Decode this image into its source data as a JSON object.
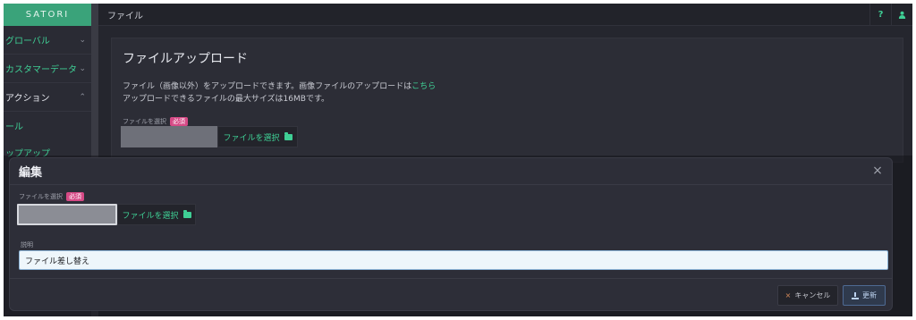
{
  "sidebar": {
    "brand": "SATORI",
    "items": [
      {
        "label": "グローバル",
        "chevron": "⌄"
      },
      {
        "label": "カスタマーデータ",
        "chevron": "⌄"
      },
      {
        "label": "アクション",
        "chevron": "⌃"
      }
    ],
    "subitems": [
      "ール",
      "ップアップ"
    ]
  },
  "topbar": {
    "title": "ファイル",
    "help": "?",
    "user_icon": "user-icon"
  },
  "card": {
    "heading": "ファイルアップロード",
    "desc_line1": "ファイル（画像以外）をアップロードできます。画像ファイルのアップロードは",
    "desc_link": "こちら",
    "desc_line2": "アップロードできるファイルの最大サイズは16MBです。",
    "file_label": "ファイルを選択",
    "required_badge": "必須",
    "pick_button": "ファイルを選択"
  },
  "modal": {
    "title": "編集",
    "close": "×",
    "file_label": "ファイルを選択",
    "required_badge": "必須",
    "pick_button": "ファイルを選択",
    "description_label": "説明",
    "description_value": "ファイル差し替え",
    "cancel_label": "キャンセル",
    "cancel_icon": "×",
    "update_label": "更新"
  },
  "colors": {
    "accent": "#3fcf95",
    "brand_bg": "#3aa37a",
    "required": "#d64a86",
    "cancel_icon": "#d88c5a"
  }
}
